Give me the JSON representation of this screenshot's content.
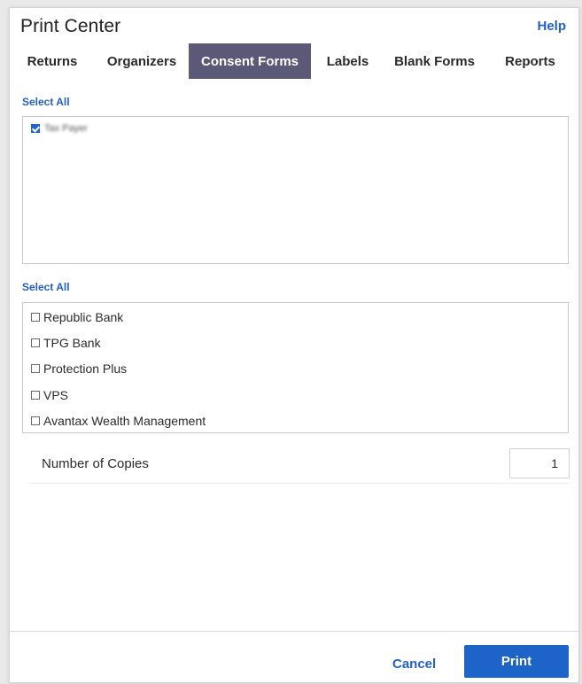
{
  "dialog": {
    "title": "Print Center",
    "help_label": "Help"
  },
  "tabs": [
    {
      "label": "Returns",
      "active": false
    },
    {
      "label": "Organizers",
      "active": false
    },
    {
      "label": "Consent Forms",
      "active": true
    },
    {
      "label": "Labels",
      "active": false
    },
    {
      "label": "Blank Forms",
      "active": false
    },
    {
      "label": "Reports",
      "active": false
    }
  ],
  "taxpayers": {
    "select_all_label": "Select All",
    "items": [
      {
        "label": "Tax Payer",
        "checked": true,
        "blurred": true
      }
    ]
  },
  "banks": {
    "select_all_label": "Select All",
    "items": [
      {
        "label": "Republic Bank",
        "checked": false
      },
      {
        "label": "TPG Bank",
        "checked": false
      },
      {
        "label": "Protection Plus",
        "checked": false
      },
      {
        "label": "VPS",
        "checked": false
      },
      {
        "label": "Avantax Wealth Management",
        "checked": false
      }
    ]
  },
  "copies": {
    "label": "Number of Copies",
    "value": "1"
  },
  "footer": {
    "cancel_label": "Cancel",
    "print_label": "Print"
  },
  "colors": {
    "accent": "#2461c6",
    "active_tab": "#5c5878",
    "primary_button": "#1e63c7"
  }
}
